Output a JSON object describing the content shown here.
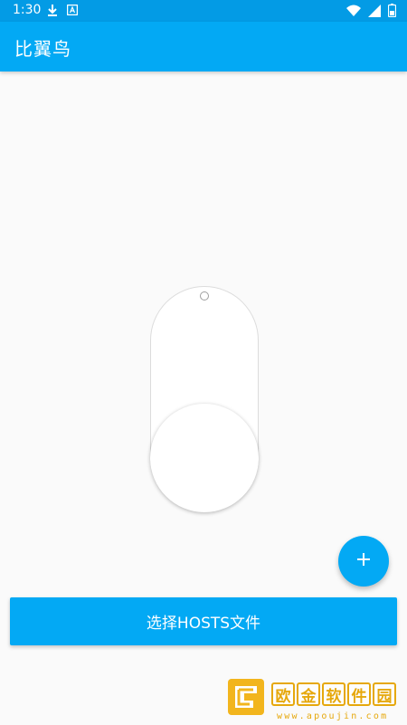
{
  "status_bar": {
    "time": "1:30",
    "left_icons": [
      "download-icon",
      "text-icon"
    ],
    "right_icons": [
      "wifi-icon",
      "signal-icon",
      "battery-icon"
    ]
  },
  "app_bar": {
    "title": "比翼鸟"
  },
  "toggle": {
    "state": "off"
  },
  "fab": {
    "icon": "plus-icon"
  },
  "select_button": {
    "label": "选择HOSTS文件"
  },
  "watermark": {
    "chars": [
      "欧",
      "金",
      "软",
      "件",
      "园"
    ],
    "url": "www.apoujin.com"
  },
  "colors": {
    "primary": "#03a9f4",
    "primary_dark": "#039be5",
    "background": "#fafafa",
    "watermark": "#e6a80c"
  }
}
